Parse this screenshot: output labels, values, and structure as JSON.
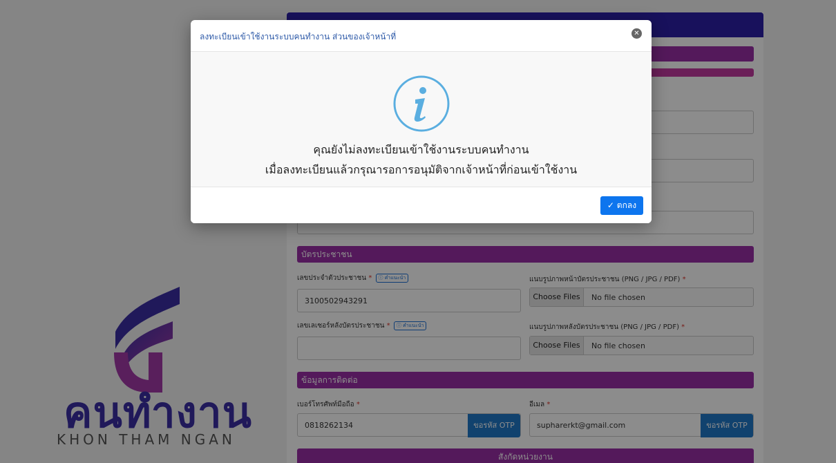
{
  "logo": {
    "thai_text": "คนทำงาน",
    "english_text": "KHON THAM NGAN",
    "colors": {
      "primary": "#3b2fa5",
      "accent": "#a33aa8"
    }
  },
  "form": {
    "section_id_card": "บัตรประชาชน",
    "id_number_label": "เลขประจำตัวประชาชน",
    "id_number_value": "3100502943291",
    "hint_label": "คำแนะนำ",
    "id_front_label": "แนบรูปภาพหน้าบัตรประชาชน (PNG / JPG / PDF)",
    "laser_label": "เลขเลเซอร์หลังบัตรประชาชน",
    "laser_value": "",
    "id_back_label": "แนบรูปภาพหลังบัตรประชาชน (PNG / JPG / PDF)",
    "choose_files": "Choose Files",
    "no_file": "No file chosen",
    "required_mark": "*",
    "section_contact": "ข้อมูลการติดต่อ",
    "phone_label": "เบอร์โทรศัพท์มือถือ",
    "phone_value": "0818262134",
    "otp_button": "ขอรหัส OTP",
    "email_label": "อีเมล",
    "email_value": "supharerkt@gmail.com",
    "section_agency": "สังกัดหน่วยงาน"
  },
  "modal": {
    "title": "ลงทะเบียนเข้าใช้งานระบบคนทำงาน ส่วนของเจ้าหน้าที่",
    "message_line1": "คุณยังไม่ลงทะเบียนเข้าใช้งานระบบคนทำงาน",
    "message_line2": "เมื่อลงทะเบียนแล้วกรุณารอการอนุมัติจากเจ้าหน้าที่ก่อนเข้าใช้งาน",
    "ok_button": "ตกลง",
    "icon": "info-icon",
    "colors": {
      "info": "#5aaee0",
      "button": "#0d75ee"
    }
  }
}
